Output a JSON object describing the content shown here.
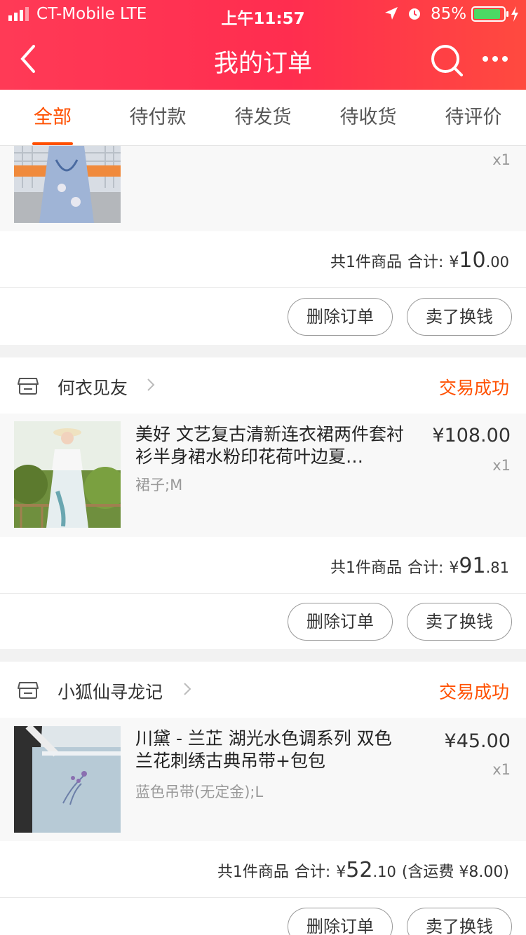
{
  "status_bar": {
    "carrier": "CT-Mobile  LTE",
    "time": "上午11:57",
    "battery": "85%"
  },
  "navbar": {
    "title": "我的订单"
  },
  "tabs": [
    {
      "label": "全部",
      "active": true
    },
    {
      "label": "待付款",
      "active": false
    },
    {
      "label": "待发货",
      "active": false
    },
    {
      "label": "待收货",
      "active": false
    },
    {
      "label": "待评价",
      "active": false
    }
  ],
  "orders": [
    {
      "item": {
        "qty": "x1"
      },
      "summary": {
        "count": "共1件商品",
        "total_label": "合计:",
        "currency": "¥",
        "int": "10",
        "dec": ".00"
      },
      "buttons": {
        "delete": "删除订单",
        "sell": "卖了换钱"
      }
    },
    {
      "shop": {
        "name": "何衣见友",
        "status": "交易成功"
      },
      "item": {
        "title": "美好 文艺复古清新连衣裙两件套衬衫半身裙水粉印花荷叶边夏…",
        "sku": "裙子;M",
        "price": "¥108.00",
        "qty": "x1"
      },
      "summary": {
        "count": "共1件商品",
        "total_label": "合计:",
        "currency": "¥",
        "int": "91",
        "dec": ".81"
      },
      "buttons": {
        "delete": "删除订单",
        "sell": "卖了换钱"
      }
    },
    {
      "shop": {
        "name": "小狐仙寻龙记",
        "status": "交易成功"
      },
      "item": {
        "title": "川黛 - 兰芷 湖光水色调系列 双色兰花刺绣古典吊带+包包",
        "sku": "蓝色吊带(无定金);L",
        "price": "¥45.00",
        "qty": "x1"
      },
      "summary": {
        "count": "共1件商品",
        "total_label": "合计:",
        "currency": "¥",
        "int": "52",
        "dec": ".10",
        "shipping": "(含运费 ¥8.00)"
      },
      "buttons": {
        "delete": "删除订单",
        "sell": "卖了换钱"
      }
    }
  ],
  "colors": {
    "header": "#ff3a56",
    "accent": "#ff5000"
  }
}
